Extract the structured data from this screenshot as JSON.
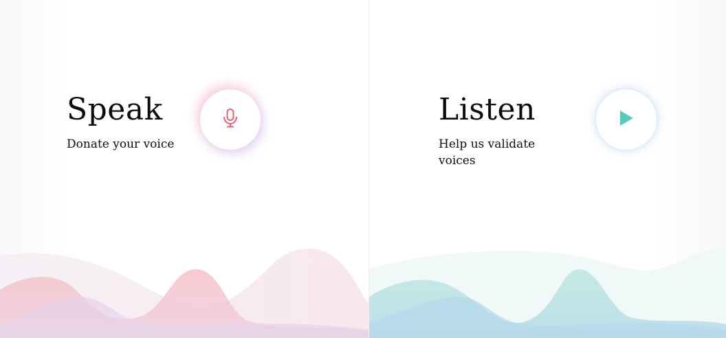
{
  "speak": {
    "title": "Speak",
    "subtitle": "Donate your voice",
    "button_icon": "microphone-icon",
    "accent_color": "#e85f73"
  },
  "listen": {
    "title": "Listen",
    "subtitle": "Help us validate voices",
    "button_icon": "play-icon",
    "accent_color": "#59cbb6"
  }
}
